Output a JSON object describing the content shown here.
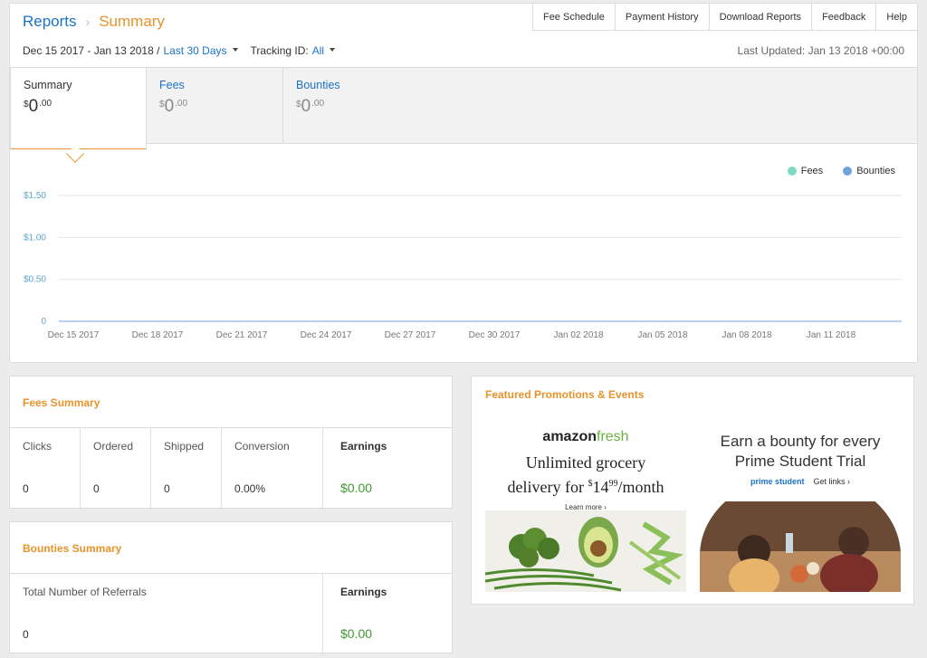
{
  "breadcrumb": {
    "reports": "Reports",
    "separator": "›",
    "summary": "Summary"
  },
  "topnav": [
    "Fee Schedule",
    "Payment History",
    "Download Reports",
    "Feedback",
    "Help"
  ],
  "filters": {
    "date_range": "Dec 15 2017 - Jan 13 2018 /",
    "period": "Last 30 Days",
    "tracking_label": "Tracking ID:",
    "tracking_value": "All"
  },
  "last_updated": "Last Updated: Jan 13 2018 +00:00",
  "tabs": [
    {
      "label": "Summary",
      "currency": "$",
      "value": "0",
      "cents": ".00"
    },
    {
      "label": "Fees",
      "currency": "$",
      "value": "0",
      "cents": ".00"
    },
    {
      "label": "Bounties",
      "currency": "$",
      "value": "0",
      "cents": ".00"
    }
  ],
  "legend": [
    {
      "label": "Fees",
      "color": "#7fd8c0"
    },
    {
      "label": "Bounties",
      "color": "#6fa3dc"
    }
  ],
  "chart_data": {
    "type": "line",
    "x": [
      "Dec 15 2017",
      "Dec 18 2017",
      "Dec 21 2017",
      "Dec 24 2017",
      "Dec 27 2017",
      "Dec 30 2017",
      "Jan 02 2018",
      "Jan 05 2018",
      "Jan 08 2018",
      "Jan 11 2018"
    ],
    "yticks": [
      "0",
      "$0.50",
      "$1.00",
      "$1.50"
    ],
    "ylim": [
      0,
      1.5
    ],
    "series": [
      {
        "name": "Fees",
        "values": [
          0,
          0,
          0,
          0,
          0,
          0,
          0,
          0,
          0,
          0
        ]
      },
      {
        "name": "Bounties",
        "values": [
          0,
          0,
          0,
          0,
          0,
          0,
          0,
          0,
          0,
          0
        ]
      }
    ],
    "grid": true,
    "legend_position": "top-right"
  },
  "fees_summary": {
    "title": "Fees Summary",
    "columns": [
      {
        "header": "Clicks",
        "value": "0"
      },
      {
        "header": "Ordered",
        "value": "0"
      },
      {
        "header": "Shipped",
        "value": "0"
      },
      {
        "header": "Conversion",
        "value": "0.00%"
      },
      {
        "header": "Earnings",
        "value": "$0.00"
      }
    ]
  },
  "bounties_summary": {
    "title": "Bounties Summary",
    "columns": [
      {
        "header": "Total Number of Referrals",
        "value": "0"
      },
      {
        "header": "Earnings",
        "value": "$0.00"
      }
    ]
  },
  "promotions": {
    "title": "Featured Promotions & Events",
    "fresh": {
      "logo_a": "amazon",
      "logo_b": "fresh",
      "line1": "Unlimited grocery",
      "line2_pre": "delivery for ",
      "price_sym": "$",
      "price": "14",
      "price_cents": "99",
      "line2_post": "/month",
      "learn_more": "Learn more ›"
    },
    "student": {
      "line1": "Earn a bounty for every",
      "line2": "Prime Student Trial",
      "logo": "prime student",
      "get_links": "Get links ›"
    }
  }
}
